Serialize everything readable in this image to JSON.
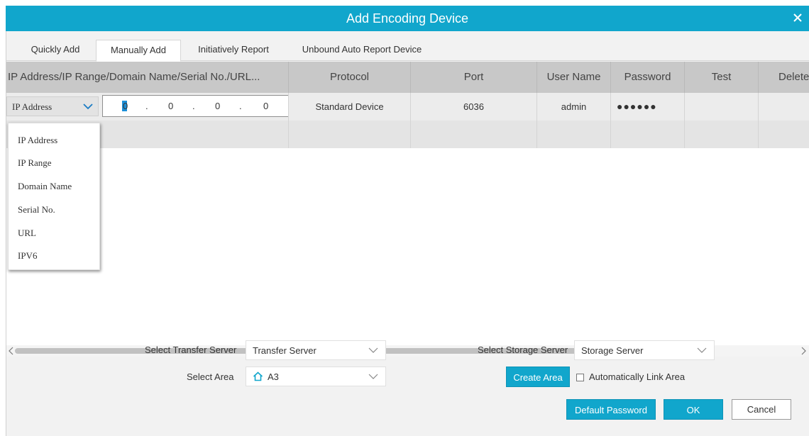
{
  "dialog": {
    "title": "Add  Encoding Device",
    "accent": "#11a6cc"
  },
  "tabs": [
    {
      "label": "Quickly Add"
    },
    {
      "label": "Manually Add",
      "active": true
    },
    {
      "label": "Initiatively Report"
    },
    {
      "label": "Unbound Auto Report Device"
    }
  ],
  "table": {
    "columns": [
      "IP Address/IP Range/Domain Name/Serial No./URL...",
      "Protocol",
      "Port",
      "User Name",
      "Password",
      "Test",
      "Delete"
    ],
    "rows": [
      {
        "address_type": "IP Address",
        "ip_segments": [
          "0",
          ".",
          "0",
          ".",
          "0",
          ".",
          "0"
        ],
        "protocol": "Standard Device",
        "port": "6036",
        "user": "admin",
        "password": "●●●●●●"
      }
    ]
  },
  "address_type_options": [
    "IP Address",
    "IP Range",
    "Domain Name",
    "Serial No.",
    "URL",
    "IPV6"
  ],
  "form": {
    "transfer_label": "Select Transfer Server",
    "transfer_value": "Transfer Server",
    "storage_label": "Select Storage Server",
    "storage_value": "Storage Server",
    "area_label": "Select Area",
    "area_value": "A3",
    "create_area": "Create Area",
    "auto_link": "Automatically Link Area"
  },
  "buttons": {
    "default_password": "Default Password",
    "ok": "OK",
    "cancel": "Cancel"
  }
}
